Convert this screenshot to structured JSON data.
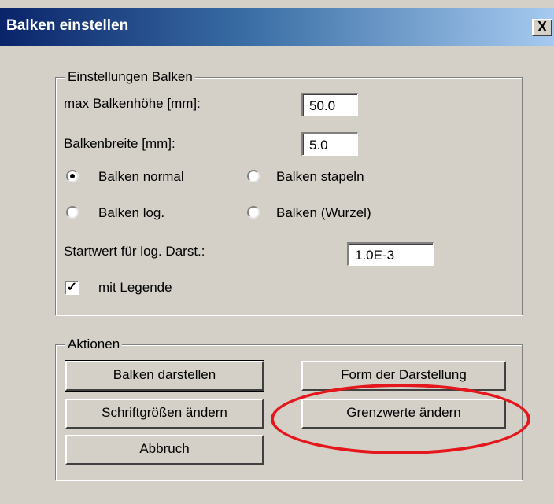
{
  "window": {
    "title": "Balken einstellen",
    "close_label": "X"
  },
  "settings_group": {
    "legend": "Einstellungen Balken",
    "max_height_label": "max Balkenhöhe [mm]:",
    "max_height_value": "50.0",
    "width_label": "Balkenbreite  [mm]:",
    "width_value": "5.0",
    "radio_normal": "Balken  normal",
    "radio_stack": "Balken  stapeln",
    "radio_log": "Balken log.",
    "radio_sqrt": "Balken (Wurzel)",
    "selected_radio": "Balken  normal",
    "start_value_label": "Startwert für log. Darst.:",
    "start_value": "1.0E-3",
    "legend_checkbox_label": "mit Legende",
    "legend_checkbox_checked": true
  },
  "actions_group": {
    "legend": "Aktionen",
    "btn_show": "Balken darstellen",
    "btn_form": "Form der Darstellung",
    "btn_font": "Schriftgrößen ändern",
    "btn_limits": "Grenzwerte ändern",
    "btn_cancel": "Abbruch"
  },
  "annotation": {
    "highlight_color": "#e4171d",
    "highlighted_item": "Grenzwerte ändern"
  }
}
